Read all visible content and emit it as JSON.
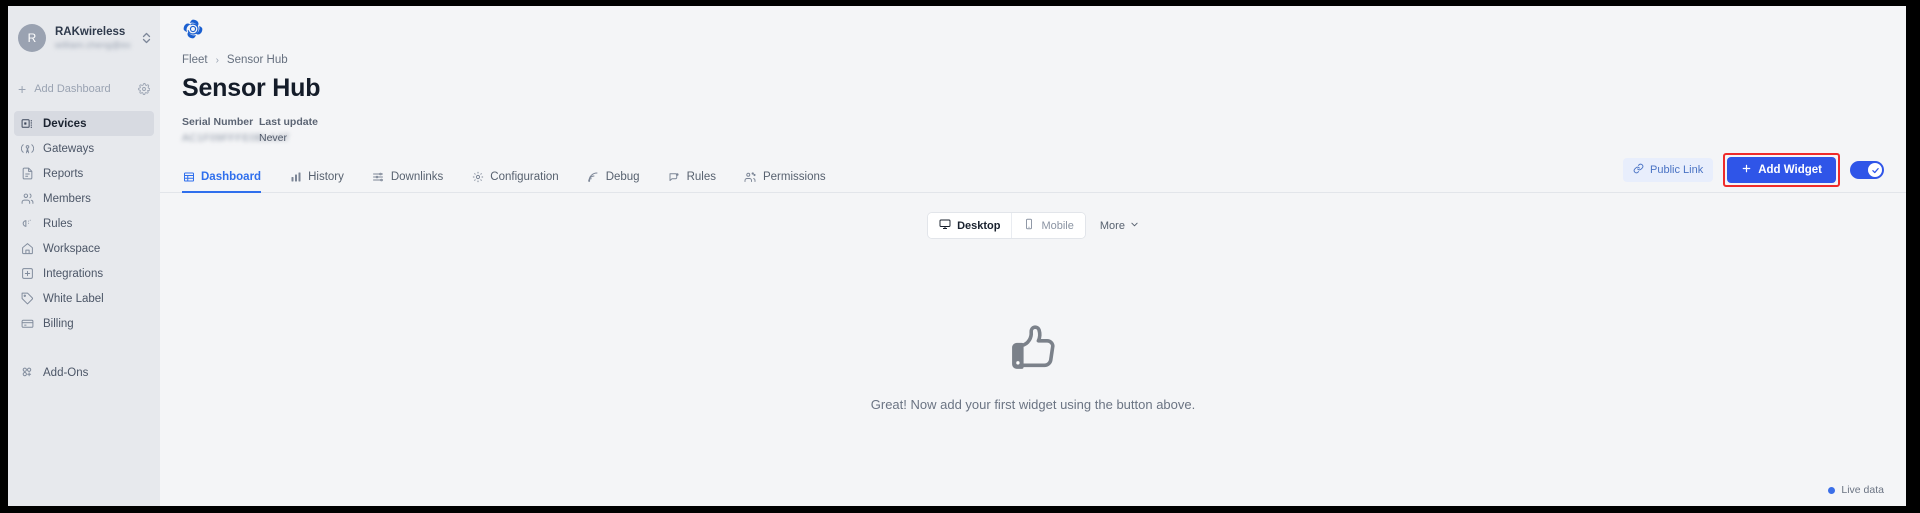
{
  "sidebar": {
    "org": {
      "avatar_initial": "R",
      "name": "RAKwireless",
      "email": "william.cheng@example.com"
    },
    "add_dashboard": {
      "label": "Add Dashboard",
      "plus_icon": "plus-icon",
      "gear_icon": "gear-icon"
    },
    "items": [
      {
        "label": "Devices",
        "icon": "devices-icon",
        "active": true
      },
      {
        "label": "Gateways",
        "icon": "gateway-icon",
        "active": false
      },
      {
        "label": "Reports",
        "icon": "document-icon",
        "active": false
      },
      {
        "label": "Members",
        "icon": "users-icon",
        "active": false
      },
      {
        "label": "Rules",
        "icon": "bell-icon",
        "active": false
      },
      {
        "label": "Workspace",
        "icon": "home-icon",
        "active": false
      },
      {
        "label": "Integrations",
        "icon": "plus-square-icon",
        "active": false
      },
      {
        "label": "White Label",
        "icon": "tag-icon",
        "active": false
      },
      {
        "label": "Billing",
        "icon": "billing-icon",
        "active": false
      },
      {
        "label": "Add-Ons",
        "icon": "addons-icon",
        "active": false
      }
    ]
  },
  "header": {
    "logo_icon": "rak-logo-icon",
    "breadcrumb": {
      "root": "Fleet",
      "separator": "›",
      "current": "Sensor Hub"
    },
    "title": "Sensor Hub",
    "meta": [
      {
        "label": "Serial Number",
        "value": "AC1F09FFFE0BLAAT",
        "redacted": true
      },
      {
        "label": "Last update",
        "value": "Never",
        "redacted": false
      }
    ]
  },
  "tabs": [
    {
      "label": "Dashboard",
      "icon": "dashboard-grid-icon",
      "active": true
    },
    {
      "label": "History",
      "icon": "bar-chart-icon",
      "active": false
    },
    {
      "label": "Downlinks",
      "icon": "sliders-icon",
      "active": false
    },
    {
      "label": "Configuration",
      "icon": "gear-icon",
      "active": false
    },
    {
      "label": "Debug",
      "icon": "signal-icon",
      "active": false
    },
    {
      "label": "Rules",
      "icon": "speech-bubble-icon",
      "active": false
    },
    {
      "label": "Permissions",
      "icon": "users-icon",
      "active": false
    }
  ],
  "actions": {
    "public_link": {
      "label": "Public Link",
      "icon": "link-icon"
    },
    "add_widget": {
      "label": "Add Widget",
      "icon": "plus-icon",
      "highlight_color": "#ef2b2b",
      "bg_color": "#2f55e8"
    },
    "toggle": {
      "state": "on",
      "color": "#2f55e8",
      "icon": "check-icon"
    }
  },
  "view_switch": {
    "options": [
      {
        "label": "Desktop",
        "icon": "monitor-icon",
        "active": true
      },
      {
        "label": "Mobile",
        "icon": "phone-icon",
        "active": false
      }
    ],
    "more": {
      "label": "More",
      "icon": "chevron-down-icon"
    }
  },
  "empty_state": {
    "icon": "thumbs-up-icon",
    "message": "Great! Now add your first widget using the button above."
  },
  "status": {
    "live_data": {
      "label": "Live data",
      "dot_color": "#3b6fe8"
    }
  }
}
